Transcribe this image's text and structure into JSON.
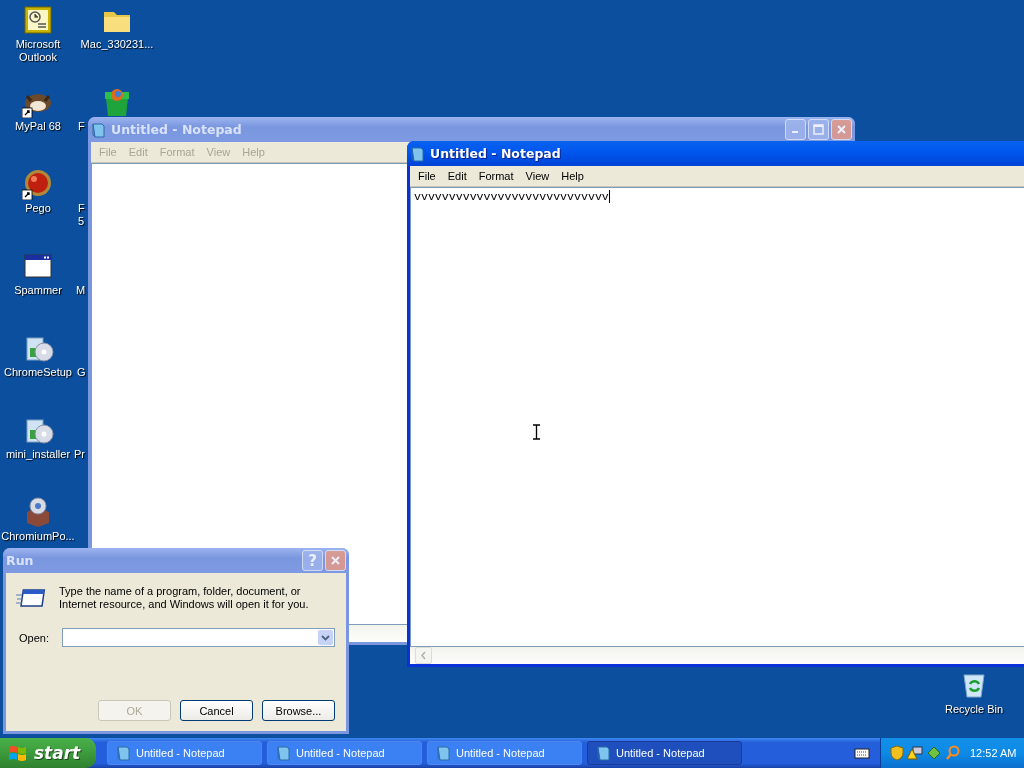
{
  "desktop": {
    "icons": [
      {
        "label": "Microsoft Outlook"
      },
      {
        "label": "Mac_330231..."
      },
      {
        "label": "MyPal 68"
      },
      {
        "label": "F"
      },
      {
        "label": "Pego"
      },
      {
        "label": "Spammer"
      },
      {
        "label": "ChromeSetup"
      },
      {
        "label": "mini_installer"
      },
      {
        "label": "ChromiumPo..."
      },
      {
        "label": "Recycle Bin"
      }
    ],
    "cut_labels": [
      "F\n5",
      "M",
      "G",
      "Pr"
    ]
  },
  "windows": [
    {
      "title": "Untitled - Notepad",
      "active": false,
      "menu": [
        "File",
        "Edit",
        "Format",
        "View",
        "Help"
      ]
    },
    {
      "title": "Untitled - Notepad",
      "active": true,
      "menu": [
        "File",
        "Edit",
        "Format",
        "View",
        "Help"
      ],
      "text": "vvvvvvvvvvvvvvvvvvvvvvvvvvvv"
    }
  ],
  "run_dialog": {
    "title": "Run",
    "active": false,
    "help_button": "?",
    "message": "Type the name of a program, folder, document, or Internet resource, and Windows will open it for you.",
    "open_label": "Open:",
    "buttons": [
      {
        "label": "OK",
        "disabled": true
      },
      {
        "label": "Cancel",
        "disabled": false
      },
      {
        "label": "Browse...",
        "disabled": false
      }
    ]
  },
  "taskbar": {
    "start": "start",
    "tasks": [
      {
        "label": "Untitled - Notepad",
        "selected": false
      },
      {
        "label": "Untitled - Notepad",
        "selected": false
      },
      {
        "label": "Untitled - Notepad",
        "selected": false
      },
      {
        "label": "Untitled - Notepad",
        "selected": true
      }
    ],
    "clock": "12:52 AM"
  }
}
